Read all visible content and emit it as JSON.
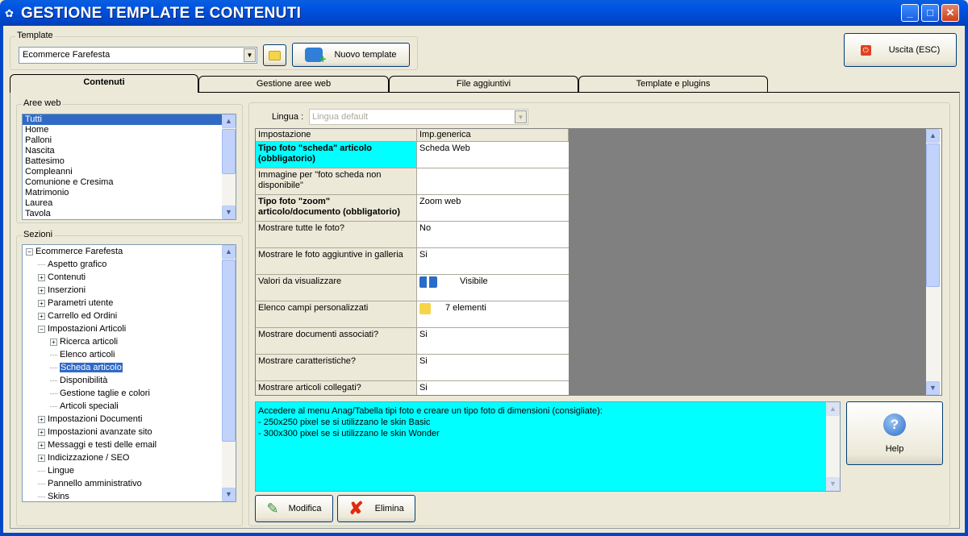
{
  "window": {
    "title": "GESTIONE TEMPLATE E CONTENUTI",
    "minimize": "_",
    "maximize": "□",
    "close": "✕"
  },
  "template_group": {
    "label": "Template",
    "selected": "Ecommerce Farefesta",
    "new_button": "Nuovo template"
  },
  "exit_button": "Uscita (ESC)",
  "tabs": [
    {
      "label": "Contenuti",
      "active": true
    },
    {
      "label": "Gestione aree web"
    },
    {
      "label": "File aggiuntivi"
    },
    {
      "label": "Template e plugins"
    }
  ],
  "aree_web": {
    "label": "Aree web",
    "items": [
      "Tutti",
      "Home",
      "Palloni",
      "Nascita",
      "Battesimo",
      "Compleanni",
      "Comunione e Cresima",
      "Matrimonio",
      "Laurea",
      "Tavola"
    ],
    "selected": "Tutti"
  },
  "sezioni": {
    "label": "Sezioni",
    "items": [
      {
        "label": "Ecommerce Farefesta",
        "level": 0,
        "expander": "minus"
      },
      {
        "label": "Aspetto grafico",
        "level": 1,
        "expander": "none"
      },
      {
        "label": "Contenuti",
        "level": 1,
        "expander": "plus"
      },
      {
        "label": "Inserzioni",
        "level": 1,
        "expander": "plus"
      },
      {
        "label": "Parametri utente",
        "level": 1,
        "expander": "plus"
      },
      {
        "label": "Carrello ed Ordini",
        "level": 1,
        "expander": "plus"
      },
      {
        "label": "Impostazioni Articoli",
        "level": 1,
        "expander": "minus"
      },
      {
        "label": "Ricerca articoli",
        "level": 2,
        "expander": "plus"
      },
      {
        "label": "Elenco articoli",
        "level": 2,
        "expander": "none"
      },
      {
        "label": "Scheda articolo",
        "level": 2,
        "expander": "none",
        "selected": true
      },
      {
        "label": "Disponibilità",
        "level": 2,
        "expander": "none"
      },
      {
        "label": "Gestione taglie e colori",
        "level": 2,
        "expander": "none"
      },
      {
        "label": "Articoli speciali",
        "level": 2,
        "expander": "none"
      },
      {
        "label": "Impostazioni Documenti",
        "level": 1,
        "expander": "plus"
      },
      {
        "label": "Impostazioni avanzate sito",
        "level": 1,
        "expander": "plus"
      },
      {
        "label": "Messaggi e testi delle email",
        "level": 1,
        "expander": "plus"
      },
      {
        "label": "Indicizzazione / SEO",
        "level": 1,
        "expander": "plus"
      },
      {
        "label": "Lingue",
        "level": 1,
        "expander": "none"
      },
      {
        "label": "Pannello amministrativo",
        "level": 1,
        "expander": "none"
      },
      {
        "label": "Skins",
        "level": 1,
        "expander": "none"
      }
    ]
  },
  "lingua": {
    "label": "Lingua :",
    "value": "Lingua default"
  },
  "grid": {
    "columns": [
      "Impostazione",
      "Imp.generica"
    ],
    "rows": [
      {
        "setting": "Tipo foto \"scheda\" articolo (obbligatorio)",
        "value": "Scheda Web",
        "bold": true,
        "highlight": true
      },
      {
        "setting": "Immagine per \"foto scheda non disponibile\"",
        "value": ""
      },
      {
        "setting": "Tipo foto \"zoom\" articolo/documento (obbligatorio)",
        "value": "Zoom web",
        "bold": true
      },
      {
        "setting": "Mostrare tutte le foto?",
        "value": "No"
      },
      {
        "setting": "Mostrare le foto aggiuntive in galleria",
        "value": "Si"
      },
      {
        "setting": "Valori da visualizzare",
        "value": "Visibile",
        "icon": "hierarchy-icon"
      },
      {
        "setting": "Elenco campi personalizzati",
        "value": "7 elementi",
        "icon": "folder-icon"
      },
      {
        "setting": "Mostrare documenti associati?",
        "value": "Si"
      },
      {
        "setting": "Mostrare caratteristiche?",
        "value": "Si"
      },
      {
        "setting": "Mostrare articoli collegati?",
        "value": "Si"
      }
    ]
  },
  "note": [
    "Accedere al menu Anag/Tabella tipi foto e creare un tipo foto di dimensioni (consigliate):",
    "- 250x250 pixel se si utilizzano le skin Basic",
    "- 300x300 pixel se si utilizzano le skin Wonder"
  ],
  "help_button": "Help",
  "modify_button": "Modifica",
  "delete_button": "Elimina",
  "colors": {
    "title_bar": "#0054e3",
    "highlight": "#00ffff",
    "selection": "#316ac5"
  }
}
